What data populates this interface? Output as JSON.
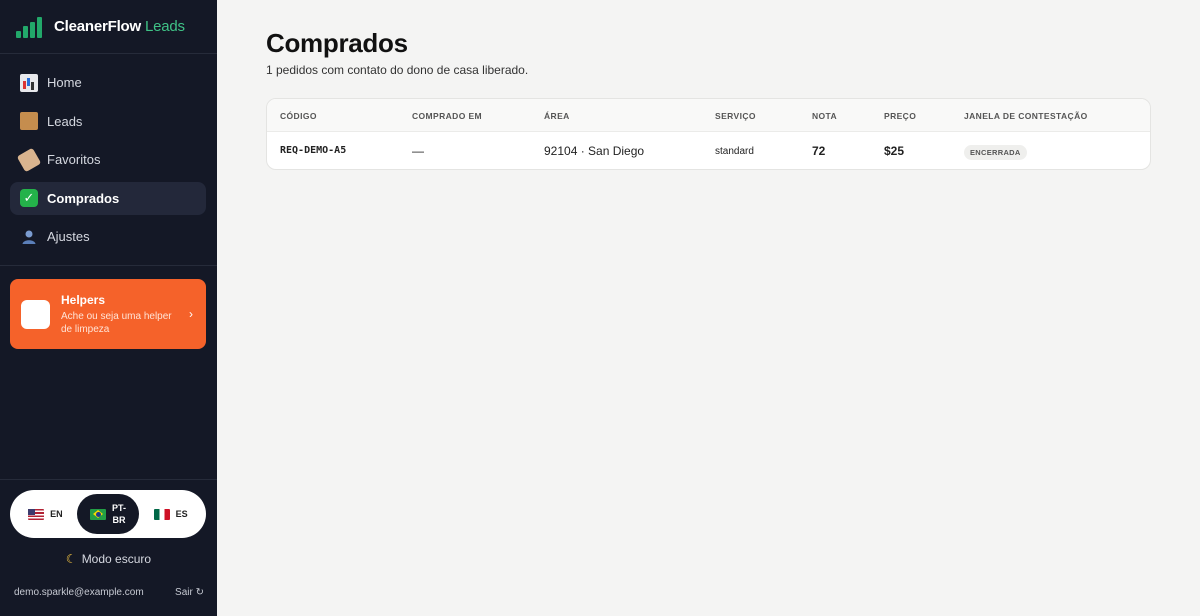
{
  "brand": {
    "name": "CleanerFlow",
    "accent": "Leads"
  },
  "nav": [
    {
      "key": "home",
      "label": "Home",
      "icon": "chart-icon"
    },
    {
      "key": "leads",
      "label": "Leads",
      "icon": "box-icon"
    },
    {
      "key": "favorites",
      "label": "Favoritos",
      "icon": "tag-icon"
    },
    {
      "key": "purchased",
      "label": "Comprados",
      "icon": "check-icon",
      "active": true
    },
    {
      "key": "settings",
      "label": "Ajustes",
      "icon": "user-icon"
    }
  ],
  "helpers": {
    "title": "Helpers",
    "description": "Ache ou seja uma helper de limpeza",
    "color": "#f5622a"
  },
  "languages": [
    {
      "code": "EN",
      "flag": "us-flag-icon"
    },
    {
      "code_line1": "PT-",
      "code_line2": "BR",
      "flag": "br-flag-icon",
      "active": true
    },
    {
      "code": "ES",
      "flag": "mx-flag-icon"
    }
  ],
  "dark_mode_label": "Modo escuro",
  "user": {
    "email": "demo.sparkle@example.com",
    "logout_label": "Sair"
  },
  "page": {
    "title": "Comprados",
    "subtitle": "1 pedidos com contato do dono de casa liberado."
  },
  "table": {
    "headers": {
      "code": "CÓDIGO",
      "purchased_at": "COMPRADO EM",
      "area": "ÁREA",
      "service": "SERVIÇO",
      "score": "NOTA",
      "price": "PREÇO",
      "dispute_window": "JANELA DE CONTESTAÇÃO"
    },
    "rows": [
      {
        "code": "REQ-DEMO-A5",
        "purchased_at": "—",
        "area": "92104 · San Diego",
        "service": "standard",
        "score": "72",
        "price": "$25",
        "dispute_window": "ENCERRADA"
      }
    ]
  },
  "colors": {
    "sidebar_bg": "#141826",
    "brand_green": "#22a86a",
    "helpers_orange": "#f5622a"
  }
}
